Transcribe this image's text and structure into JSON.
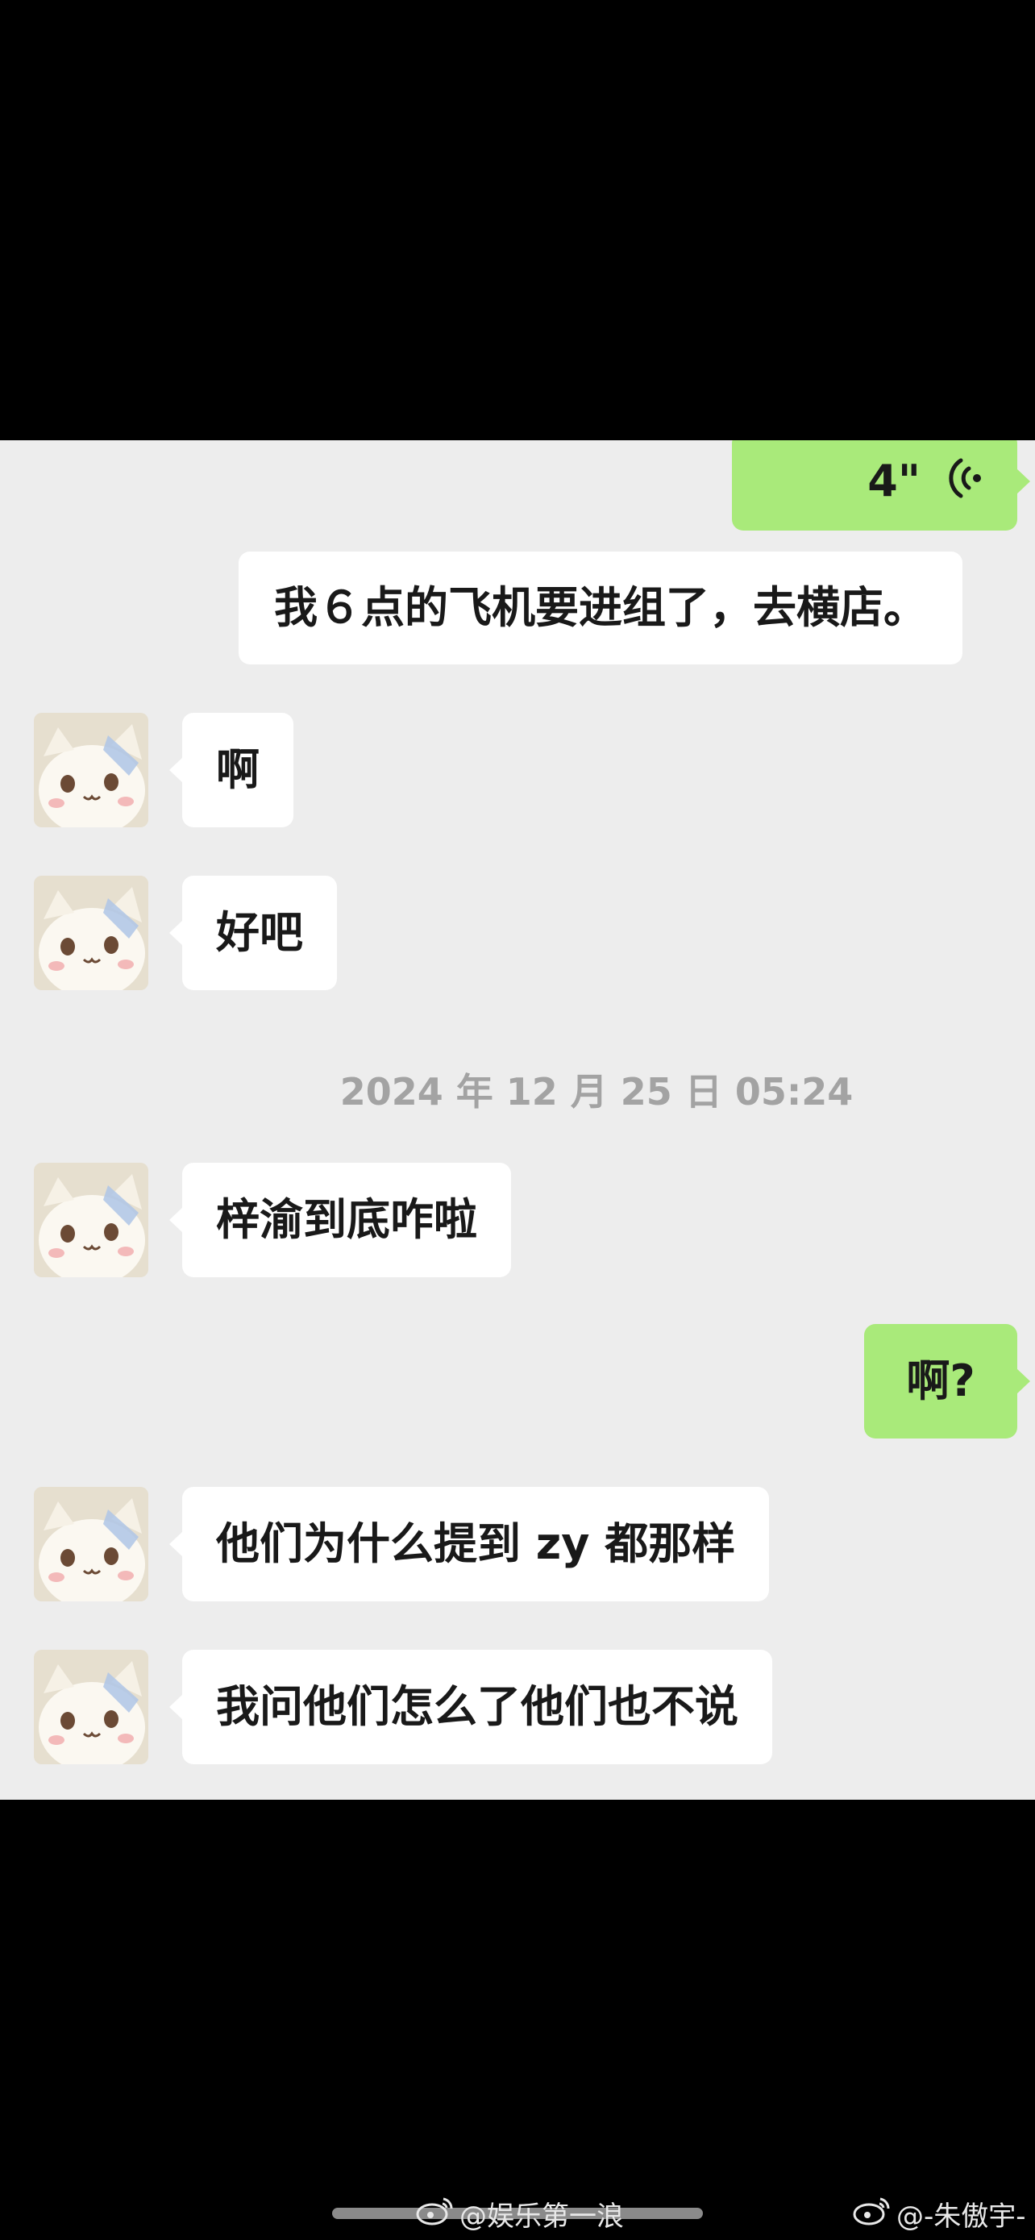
{
  "chat": {
    "voice_message": {
      "duration": "4\"",
      "icon": "voice-wave-icon"
    },
    "messages": [
      {
        "text": "我６点的飞机要进组了，去横店。"
      },
      {
        "text": "啊"
      },
      {
        "text": "好吧"
      },
      {
        "text": "梓渝到底咋啦"
      },
      {
        "text": "啊?"
      },
      {
        "text": "他们为什么提到 zy 都那样"
      },
      {
        "text": "我问他们怎么了他们也不说"
      }
    ],
    "timestamp": "2024 年 12 月 25 日 05:24"
  },
  "watermarks": [
    {
      "icon": "weibo-icon",
      "text": "@娱乐第一浪"
    },
    {
      "icon": "weibo-icon",
      "text": "@-朱傲宇-"
    }
  ],
  "colors": {
    "chat_background": "#ededed",
    "outgoing_bubble": "#a9ea7a",
    "incoming_bubble": "#ffffff",
    "timestamp_text": "#a3a3a3"
  }
}
